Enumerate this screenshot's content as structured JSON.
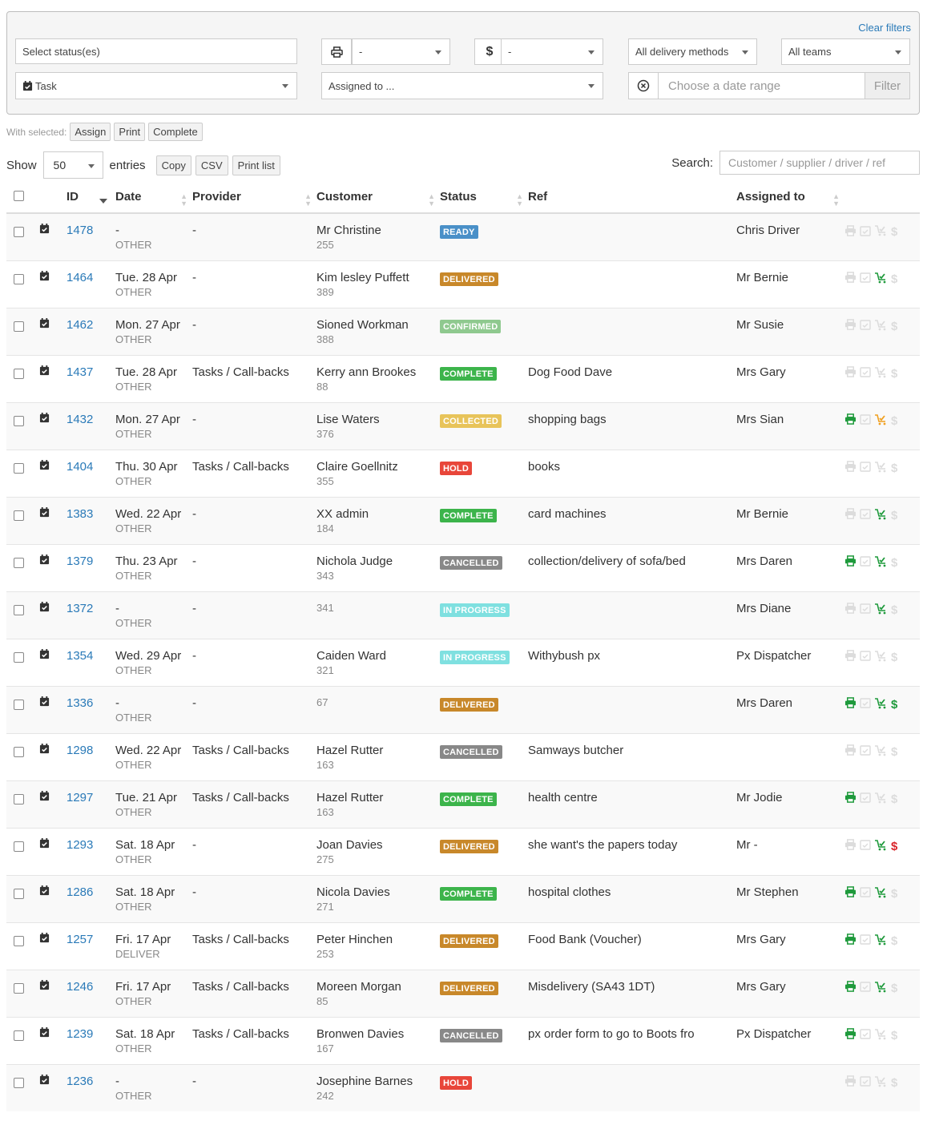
{
  "filters": {
    "clear": "Clear filters",
    "status_placeholder": "Select status(es)",
    "print_value": "-",
    "payment_value": "-",
    "delivery_methods": "All delivery methods",
    "teams": "All teams",
    "type": "Task",
    "assigned": "Assigned to ...",
    "date_placeholder": "Choose a date range",
    "filter_button": "Filter"
  },
  "bulk": {
    "label": "With selected:",
    "assign": "Assign",
    "print": "Print",
    "complete": "Complete"
  },
  "toolbar": {
    "show": "Show",
    "entries_value": "50",
    "entries": "entries",
    "copy": "Copy",
    "csv": "CSV",
    "print_list": "Print list",
    "search_label": "Search:",
    "search_placeholder": "Customer / supplier / driver / ref"
  },
  "columns": {
    "id": "ID",
    "date": "Date",
    "provider": "Provider",
    "customer": "Customer",
    "status": "Status",
    "ref": "Ref",
    "assigned": "Assigned to"
  },
  "colors": {
    "accent": "#2a7ab8",
    "active": "#1f9a3c",
    "warn": "#f0a020",
    "alert": "#d9242a",
    "inactive": "#dcdcdc"
  },
  "status_colors": {
    "READY": "#4a90c8",
    "DELIVERED": "#c8882a",
    "CONFIRMED": "#8fc98f",
    "COMPLETE": "#3cb44b",
    "COLLECTED": "#e8c45a",
    "HOLD": "#e8463a",
    "CANCELLED": "#888888",
    "IN PROGRESS": "#7fe0e0"
  },
  "rows": [
    {
      "id": "1478",
      "date": "-",
      "method": "OTHER",
      "provider": "-",
      "customer": "Mr Christine",
      "cust_id": "255",
      "status": "READY",
      "ref": "",
      "assigned": "Chris Driver",
      "icons": {
        "print": "off",
        "check": "off",
        "cart": "off",
        "dollar": "off"
      }
    },
    {
      "id": "1464",
      "date": "Tue. 28 Apr",
      "method": "OTHER",
      "provider": "-",
      "customer": "Kim lesley Puffett",
      "cust_id": "389",
      "status": "DELIVERED",
      "ref": "",
      "assigned": "Mr Bernie",
      "icons": {
        "print": "off",
        "check": "off",
        "cart": "green",
        "dollar": "off"
      }
    },
    {
      "id": "1462",
      "date": "Mon. 27 Apr",
      "method": "OTHER",
      "provider": "-",
      "customer": "Sioned Workman",
      "cust_id": "388",
      "status": "CONFIRMED",
      "ref": "",
      "assigned": "Mr Susie",
      "icons": {
        "print": "off",
        "check": "off",
        "cart": "off",
        "dollar": "off"
      }
    },
    {
      "id": "1437",
      "date": "Tue. 28 Apr",
      "method": "OTHER",
      "provider": "Tasks / Call-backs",
      "customer": "Kerry ann Brookes",
      "cust_id": "88",
      "status": "COMPLETE",
      "ref": "Dog Food Dave",
      "assigned": "Mrs Gary",
      "icons": {
        "print": "off",
        "check": "off",
        "cart": "off",
        "dollar": "off"
      }
    },
    {
      "id": "1432",
      "date": "Mon. 27 Apr",
      "method": "OTHER",
      "provider": "-",
      "customer": "Lise Waters",
      "cust_id": "376",
      "status": "COLLECTED",
      "ref": "shopping bags",
      "assigned": "Mrs Sian",
      "icons": {
        "print": "green",
        "check": "off",
        "cart": "orange",
        "dollar": "off"
      }
    },
    {
      "id": "1404",
      "date": "Thu. 30 Apr",
      "method": "OTHER",
      "provider": "Tasks / Call-backs",
      "customer": "Claire Goellnitz",
      "cust_id": "355",
      "status": "HOLD",
      "ref": "books",
      "assigned": "",
      "icons": {
        "print": "off",
        "check": "off",
        "cart": "off",
        "dollar": "off"
      }
    },
    {
      "id": "1383",
      "date": "Wed. 22 Apr",
      "method": "OTHER",
      "provider": "-",
      "customer": "XX admin",
      "cust_id": "184",
      "status": "COMPLETE",
      "ref": "card machines",
      "assigned": "Mr Bernie",
      "icons": {
        "print": "off",
        "check": "off",
        "cart": "green",
        "dollar": "off"
      }
    },
    {
      "id": "1379",
      "date": "Thu. 23 Apr",
      "method": "OTHER",
      "provider": "-",
      "customer": "Nichola Judge",
      "cust_id": "343",
      "status": "CANCELLED",
      "ref": "collection/delivery of sofa/bed",
      "assigned": "Mrs Daren",
      "icons": {
        "print": "green",
        "check": "off",
        "cart": "green",
        "dollar": "off"
      }
    },
    {
      "id": "1372",
      "date": "-",
      "method": "OTHER",
      "provider": "-",
      "customer": "",
      "cust_id": "341",
      "status": "IN PROGRESS",
      "ref": "",
      "assigned": "Mrs Diane",
      "icons": {
        "print": "off",
        "check": "off",
        "cart": "green",
        "dollar": "off"
      }
    },
    {
      "id": "1354",
      "date": "Wed. 29 Apr",
      "method": "OTHER",
      "provider": "-",
      "customer": "Caiden Ward",
      "cust_id": "321",
      "status": "IN PROGRESS",
      "ref": "Withybush px",
      "assigned": "Px Dispatcher",
      "icons": {
        "print": "off",
        "check": "off",
        "cart": "off",
        "dollar": "off"
      }
    },
    {
      "id": "1336",
      "date": "-",
      "method": "OTHER",
      "provider": "-",
      "customer": "",
      "cust_id": "67",
      "status": "DELIVERED",
      "ref": "",
      "assigned": "Mrs Daren",
      "icons": {
        "print": "green",
        "check": "off",
        "cart": "green",
        "dollar": "green"
      }
    },
    {
      "id": "1298",
      "date": "Wed. 22 Apr",
      "method": "OTHER",
      "provider": "Tasks / Call-backs",
      "customer": "Hazel Rutter",
      "cust_id": "163",
      "status": "CANCELLED",
      "ref": "Samways butcher",
      "assigned": "",
      "icons": {
        "print": "off",
        "check": "off",
        "cart": "off",
        "dollar": "off"
      }
    },
    {
      "id": "1297",
      "date": "Tue. 21 Apr",
      "method": "OTHER",
      "provider": "Tasks / Call-backs",
      "customer": "Hazel Rutter",
      "cust_id": "163",
      "status": "COMPLETE",
      "ref": "health centre",
      "assigned": "Mr Jodie",
      "icons": {
        "print": "green",
        "check": "off",
        "cart": "off",
        "dollar": "off"
      }
    },
    {
      "id": "1293",
      "date": "Sat. 18 Apr",
      "method": "OTHER",
      "provider": "-",
      "customer": "Joan Davies",
      "cust_id": "275",
      "status": "DELIVERED",
      "ref": "she want's the papers today",
      "assigned": "Mr -",
      "icons": {
        "print": "off",
        "check": "off",
        "cart": "green",
        "dollar": "red"
      }
    },
    {
      "id": "1286",
      "date": "Sat. 18 Apr",
      "method": "OTHER",
      "provider": "-",
      "customer": "Nicola Davies",
      "cust_id": "271",
      "status": "COMPLETE",
      "ref": "hospital clothes",
      "assigned": "Mr Stephen",
      "icons": {
        "print": "green",
        "check": "off",
        "cart": "green",
        "dollar": "off"
      }
    },
    {
      "id": "1257",
      "date": "Fri. 17 Apr",
      "method": "DELIVER",
      "provider": "Tasks / Call-backs",
      "customer": "Peter Hinchen",
      "cust_id": "253",
      "status": "DELIVERED",
      "ref": "Food Bank (Voucher)",
      "assigned": "Mrs Gary",
      "icons": {
        "print": "green",
        "check": "off",
        "cart": "green",
        "dollar": "off"
      }
    },
    {
      "id": "1246",
      "date": "Fri. 17 Apr",
      "method": "OTHER",
      "provider": "Tasks / Call-backs",
      "customer": "Moreen Morgan",
      "cust_id": "85",
      "status": "DELIVERED",
      "ref": "Misdelivery (SA43 1DT)",
      "assigned": "Mrs Gary",
      "icons": {
        "print": "green",
        "check": "off",
        "cart": "green",
        "dollar": "off"
      }
    },
    {
      "id": "1239",
      "date": "Sat. 18 Apr",
      "method": "OTHER",
      "provider": "Tasks / Call-backs",
      "customer": "Bronwen Davies",
      "cust_id": "167",
      "status": "CANCELLED",
      "ref": "px order form to go to Boots fro",
      "assigned": "Px Dispatcher",
      "icons": {
        "print": "green",
        "check": "off",
        "cart": "off",
        "dollar": "off"
      }
    },
    {
      "id": "1236",
      "date": "-",
      "method": "OTHER",
      "provider": "-",
      "customer": "Josephine Barnes",
      "cust_id": "242",
      "status": "HOLD",
      "ref": "",
      "assigned": "",
      "icons": {
        "print": "off",
        "check": "off",
        "cart": "off",
        "dollar": "off"
      }
    }
  ]
}
